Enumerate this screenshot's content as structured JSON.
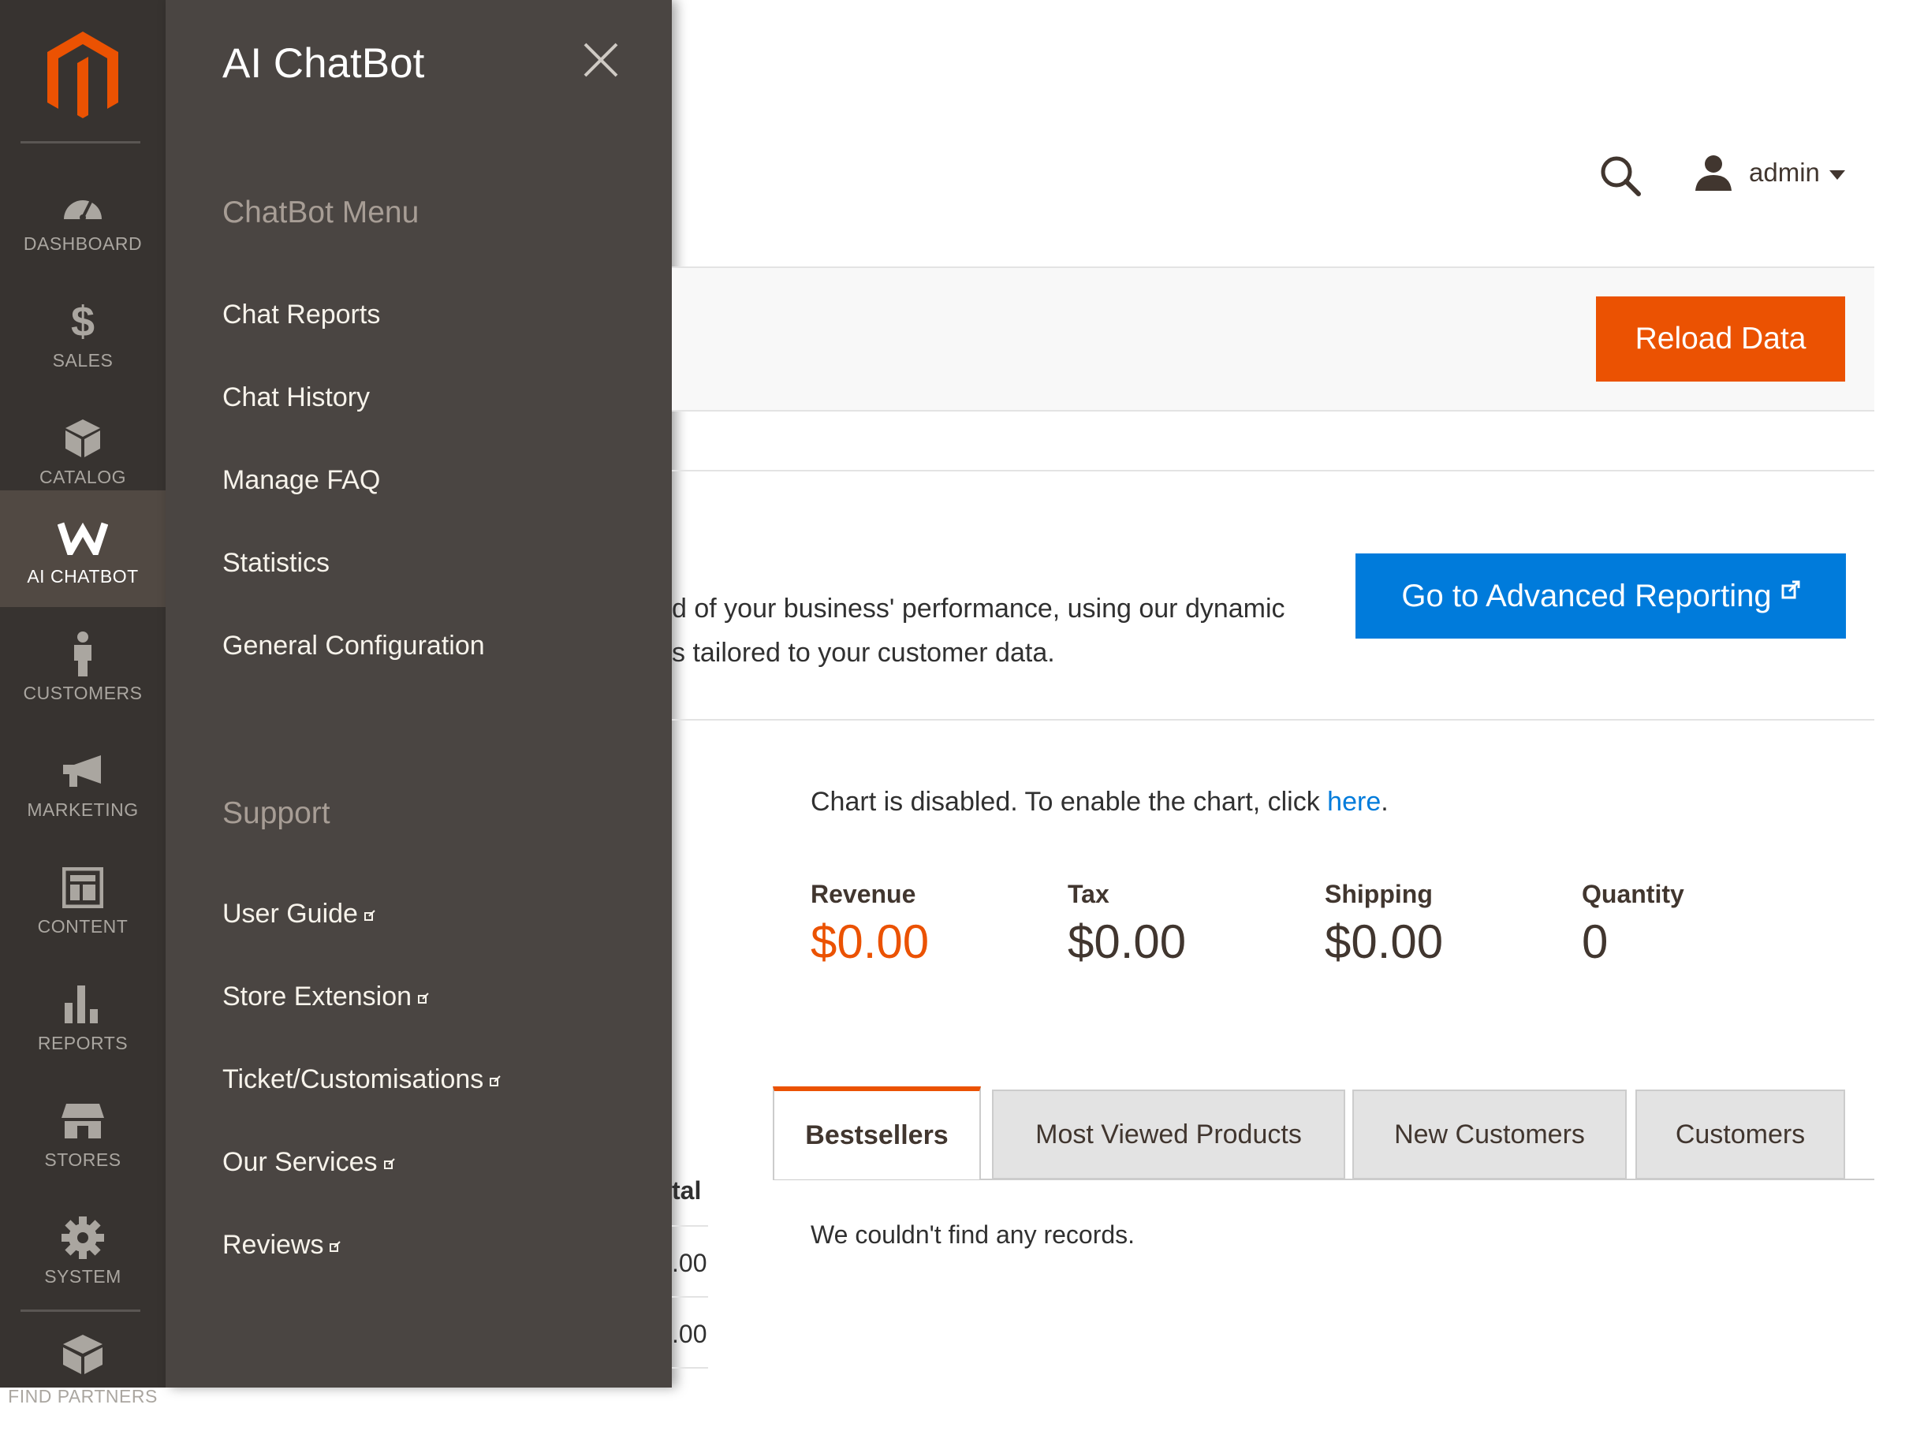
{
  "nav": {
    "items": [
      {
        "key": "dashboard",
        "label": "DASHBOARD"
      },
      {
        "key": "sales",
        "label": "SALES"
      },
      {
        "key": "catalog",
        "label": "CATALOG"
      },
      {
        "key": "ai-chatbot",
        "label": "AI CHATBOT",
        "active": true
      },
      {
        "key": "customers",
        "label": "CUSTOMERS"
      },
      {
        "key": "marketing",
        "label": "MARKETING"
      },
      {
        "key": "content",
        "label": "CONTENT"
      },
      {
        "key": "reports",
        "label": "REPORTS"
      },
      {
        "key": "stores",
        "label": "STORES"
      },
      {
        "key": "system",
        "label": "SYSTEM"
      },
      {
        "key": "find-partners",
        "label": "FIND PARTNERS"
      }
    ]
  },
  "panel": {
    "title": "AI ChatBot",
    "menu_section": "ChatBot Menu",
    "menu_items": [
      "Chat Reports",
      "Chat History",
      "Manage FAQ",
      "Statistics",
      "General Configuration"
    ],
    "support_section": "Support",
    "support_items": [
      "User Guide",
      "Store Extension",
      "Ticket/Customisations",
      "Our Services",
      "Reviews"
    ]
  },
  "header": {
    "user": "admin"
  },
  "actions": {
    "reload": "Reload Data"
  },
  "reporting": {
    "line1": "d of your business' performance, using our dynamic",
    "line2": "s tailored to your customer data.",
    "button": "Go to Advanced Reporting"
  },
  "chart": {
    "disabled_text": "Chart is disabled. To enable the chart, click ",
    "link": "here",
    "period": "."
  },
  "totals": {
    "revenue_label": "Revenue",
    "revenue": "$0.00",
    "tax_label": "Tax",
    "tax": "$0.00",
    "shipping_label": "Shipping",
    "shipping": "$0.00",
    "quantity_label": "Quantity",
    "quantity": "0"
  },
  "tabs": [
    "Bestsellers",
    "Most Viewed Products",
    "New Customers",
    "Customers"
  ],
  "no_records": "We couldn't find any records.",
  "grid_peek": {
    "header": "tal",
    "rows": [
      ".00",
      ".00"
    ]
  },
  "colors": {
    "accent": "#eb5202",
    "link": "#007bdb",
    "nav_bg": "#373330",
    "panel_bg": "#4a4542"
  }
}
